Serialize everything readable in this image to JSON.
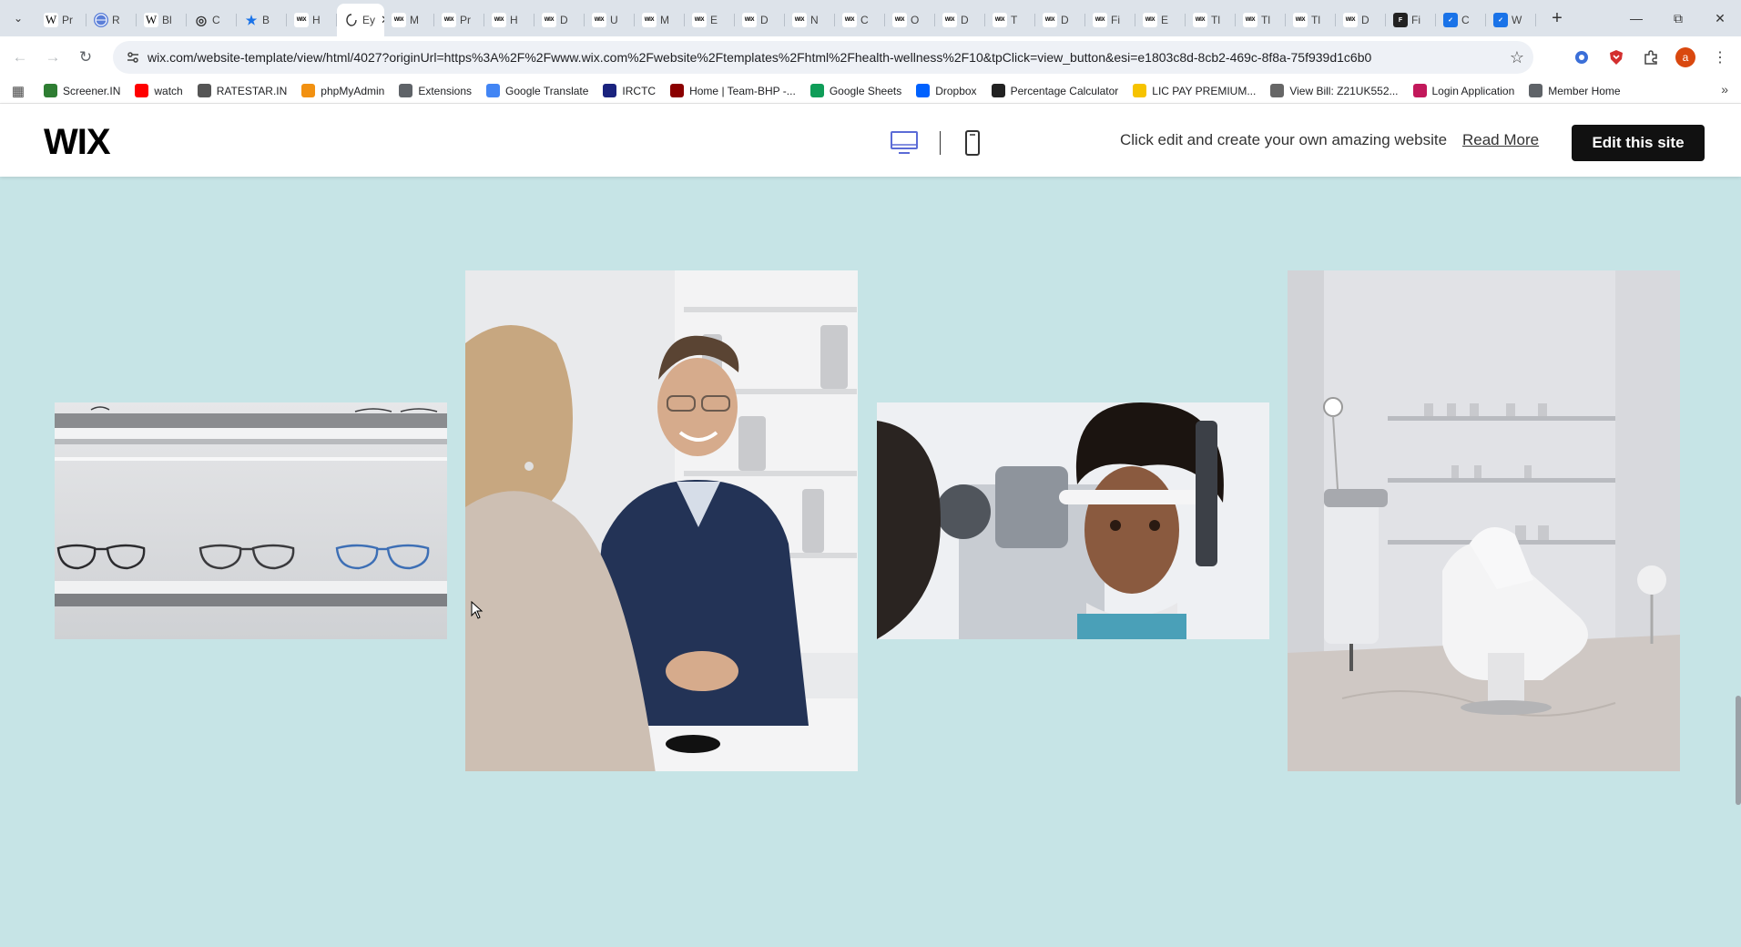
{
  "browser": {
    "tabs": [
      {
        "icon": "wikipedia-icon",
        "glyph": "W",
        "label": "Pr"
      },
      {
        "icon": "globe-icon",
        "glyph": "",
        "label": "R"
      },
      {
        "icon": "wikipedia-icon",
        "glyph": "W",
        "label": "Bl"
      },
      {
        "icon": "target-icon",
        "glyph": "◎",
        "label": "C"
      },
      {
        "icon": "star-icon",
        "glyph": "★",
        "label": "B"
      },
      {
        "icon": "wix-icon",
        "glyph": "WIX",
        "label": "H"
      },
      {
        "icon": "wix-icon",
        "glyph": "WIX",
        "label": "M"
      },
      {
        "icon": "wix-icon",
        "glyph": "WIX",
        "label": "Pr"
      },
      {
        "icon": "wix-icon",
        "glyph": "WIX",
        "label": "H"
      },
      {
        "icon": "wix-icon",
        "glyph": "WIX",
        "label": "D"
      },
      {
        "icon": "wix-icon",
        "glyph": "WIX",
        "label": "U"
      },
      {
        "icon": "wix-icon",
        "glyph": "WIX",
        "label": "M"
      },
      {
        "icon": "wix-icon",
        "glyph": "WIX",
        "label": "E"
      },
      {
        "icon": "wix-icon",
        "glyph": "WIX",
        "label": "D"
      },
      {
        "icon": "wix-icon",
        "glyph": "WIX",
        "label": "N"
      },
      {
        "icon": "wix-icon",
        "glyph": "WIX",
        "label": "C"
      },
      {
        "icon": "wix-icon",
        "glyph": "WIX",
        "label": "O"
      },
      {
        "icon": "wix-icon",
        "glyph": "WIX",
        "label": "D"
      },
      {
        "icon": "wix-icon",
        "glyph": "WIX",
        "label": "T"
      },
      {
        "icon": "wix-icon",
        "glyph": "WIX",
        "label": "D"
      },
      {
        "icon": "wix-icon",
        "glyph": "WIX",
        "label": "Fi"
      },
      {
        "icon": "wix-icon",
        "glyph": "WIX",
        "label": "E"
      },
      {
        "icon": "wix-icon",
        "glyph": "WIX",
        "label": "Tl"
      },
      {
        "icon": "wix-icon",
        "glyph": "WIX",
        "label": "Tl"
      },
      {
        "icon": "wix-icon",
        "glyph": "WIX",
        "label": "Tl"
      },
      {
        "icon": "wix-icon",
        "glyph": "WIX",
        "label": "D"
      },
      {
        "icon": "framer-icon",
        "glyph": "F",
        "label": "Fi"
      },
      {
        "icon": "bookmark-blue-icon",
        "glyph": "✓",
        "label": "C"
      },
      {
        "icon": "bookmark-blue-icon",
        "glyph": "✓",
        "label": "W"
      }
    ],
    "active_tab": {
      "label": "Ey",
      "index": 6
    },
    "url": "wix.com/website-template/view/html/4027?originUrl=https%3A%2F%2Fwww.wix.com%2Fwebsite%2Ftemplates%2Fhtml%2Fhealth-wellness%2F10&tpClick=view_button&esi=e1803c8d-8cb2-469c-8f8a-75f939d1c6b0",
    "profile_initial": "a",
    "bookmarks": [
      {
        "label": "Screener.IN",
        "icon": "chart-icon",
        "color": "#2e7d32"
      },
      {
        "label": "watch",
        "icon": "youtube-icon",
        "color": "#ff0000"
      },
      {
        "label": "RATESTAR.IN",
        "icon": "ratestar-icon",
        "color": "#555555"
      },
      {
        "label": "phpMyAdmin",
        "icon": "phpmyadmin-icon",
        "color": "#f29111"
      },
      {
        "label": "Extensions",
        "icon": "puzzle-icon",
        "color": "#5f6368"
      },
      {
        "label": "Google Translate",
        "icon": "translate-icon",
        "color": "#4285f4"
      },
      {
        "label": "IRCTC",
        "icon": "irctc-icon",
        "color": "#1a237e"
      },
      {
        "label": "Home | Team-BHP -...",
        "icon": "teambhp-icon",
        "color": "#8b0000"
      },
      {
        "label": "Google Sheets",
        "icon": "sheets-icon",
        "color": "#0f9d58"
      },
      {
        "label": "Dropbox",
        "icon": "dropbox-icon",
        "color": "#0061fe"
      },
      {
        "label": "Percentage Calculator",
        "icon": "percent-icon",
        "color": "#222222"
      },
      {
        "label": "LIC PAY PREMIUM...",
        "icon": "lic-icon",
        "color": "#f6c300"
      },
      {
        "label": "View Bill: Z21UK552...",
        "icon": "bill-icon",
        "color": "#666666"
      },
      {
        "label": "Login Application",
        "icon": "login-icon",
        "color": "#c2185b"
      },
      {
        "label": "Member Home",
        "icon": "globe-icon",
        "color": "#5f6368"
      }
    ]
  },
  "wix": {
    "logo": "WIX",
    "tagline": "Click edit and create your own amazing website",
    "read_more": "Read More",
    "edit_button": "Edit this site",
    "accent": "#5b6bd6"
  },
  "page": {
    "background": "#c6e4e6",
    "photos": [
      {
        "name": "eyeglasses-shelf-photo"
      },
      {
        "name": "optician-consultation-photo"
      },
      {
        "name": "eye-exam-photo"
      },
      {
        "name": "exam-room-chair-photo"
      }
    ]
  }
}
